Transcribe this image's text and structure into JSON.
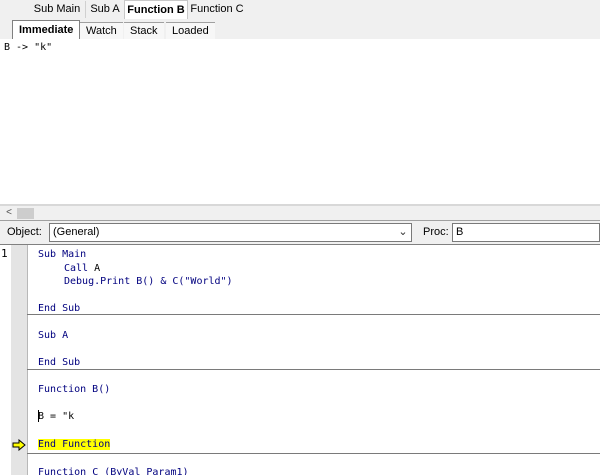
{
  "top_tabs": [
    "Sub Main",
    "Sub A",
    "Function B",
    "Function C"
  ],
  "active_top_tab": "Function B",
  "sub_tabs": [
    "Immediate",
    "Watch",
    "Stack",
    "Loaded"
  ],
  "active_sub_tab": "Immediate",
  "immediate": {
    "output": "B -> \"k\""
  },
  "scrollbar": {
    "left_arrow": "<"
  },
  "object_combo": {
    "label": "Object:",
    "value": "(General)"
  },
  "proc_combo": {
    "label": "Proc:",
    "value": "B"
  },
  "gutter": {
    "line_number": "1"
  },
  "code": {
    "sub_main": "Sub Main",
    "call_a_kw": "Call",
    "call_a_rest": " A",
    "debug_print": "Debug.Print B() & C(\"World\")",
    "end_sub_1": "End Sub",
    "sub_a": "Sub A",
    "end_sub_2": "End Sub",
    "function_b": "Function B()",
    "assign": "B = \"k",
    "end_function": "End Function",
    "function_c_kw": "Function",
    "function_c_rest": " C (ByVal Param1)"
  },
  "colors": {
    "keyword": "#00007f",
    "highlight": "#ffff00",
    "exec_arrow": "#ffff00"
  }
}
